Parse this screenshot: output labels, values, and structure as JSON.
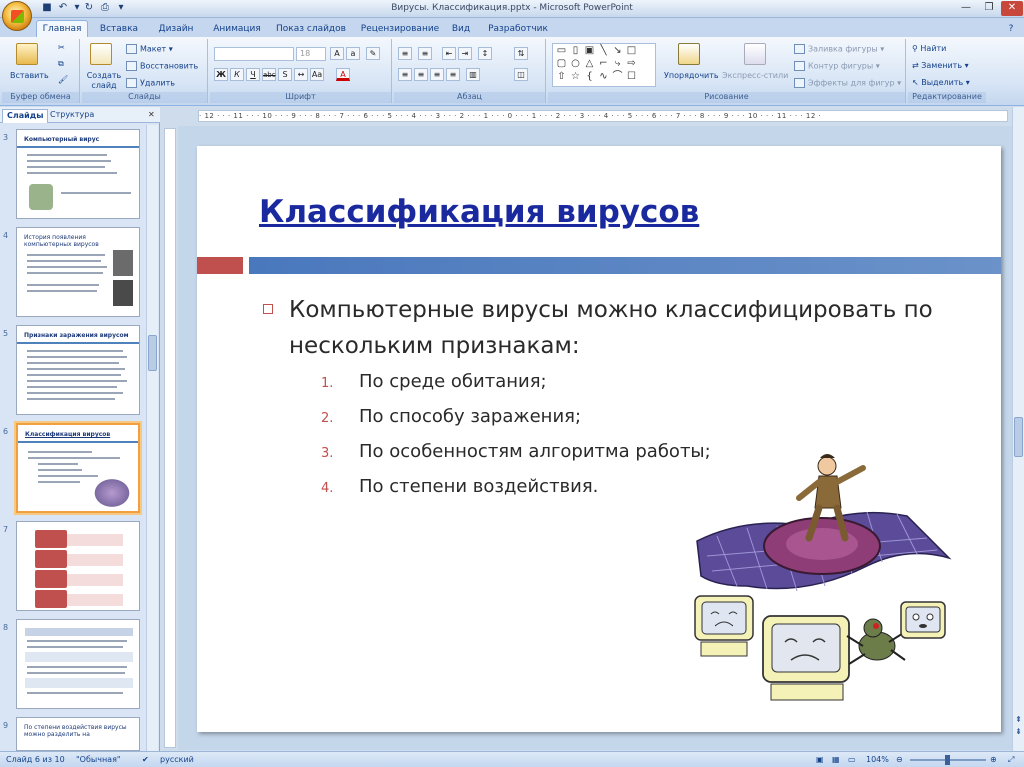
{
  "window": {
    "title": "Вирусы. Классификация.pptx - Microsoft PowerPoint"
  },
  "tabs": [
    "Главная",
    "Вставка",
    "Дизайн",
    "Анимация",
    "Показ слайдов",
    "Рецензирование",
    "Вид",
    "Разработчик"
  ],
  "ribbon": {
    "clipboard": {
      "paste": "Вставить",
      "label": "Буфер обмена"
    },
    "slides": {
      "new_slide": "Создать слайд",
      "layout": "Макет",
      "reset": "Восстановить",
      "delete": "Удалить",
      "label": "Слайды"
    },
    "font": {
      "size": "18",
      "bold": "Ж",
      "italic": "К",
      "underline": "Ч",
      "strike": "abc",
      "label": "Шрифт"
    },
    "paragraph": {
      "label": "Абзац"
    },
    "drawing": {
      "arrange": "Упорядочить",
      "quick_styles": "Экспресс-стили",
      "fill": "Заливка фигуры",
      "outline": "Контур фигуры",
      "effects": "Эффекты для фигур",
      "label": "Рисование"
    },
    "editing": {
      "find": "Найти",
      "replace": "Заменить",
      "select": "Выделить",
      "label": "Редактирование"
    }
  },
  "panel": {
    "tab_slides": "Слайды",
    "tab_outline": "Структура",
    "thumbnails": [
      {
        "num": "3",
        "title": "Компьютерный вирус"
      },
      {
        "num": "4",
        "title": "История появления компьютерных вирусов"
      },
      {
        "num": "5",
        "title": "Признаки заражения вирусом"
      },
      {
        "num": "6",
        "title": "Классификация вирусов"
      },
      {
        "num": "7",
        "title": ""
      },
      {
        "num": "8",
        "title": ""
      },
      {
        "num": "9",
        "title": "По степени воздействия вирусы можно разделить на"
      }
    ]
  },
  "ruler": {
    "h_ticks": "· 12 · · · 11 · · · 10 · · · 9 · · · 8 · · · 7 · · · 6 · · · 5 · · · 4 · · · 3 · · · 2 · · · 1 · · · 0 · · · 1 · · · 2 · · · 3 · · · 4 · · · 5 · · · 6 · · · 7 · · · 8 · · · 9 · · · 10 · · · 11 · · · 12 ·"
  },
  "slide": {
    "title": "Классификация вирусов",
    "bullet": "Компьютерные вирусы можно классифицировать по нескольким признакам:",
    "items": [
      {
        "n": "1.",
        "text": "По среде обитания;"
      },
      {
        "n": "2.",
        "text": "По способу заражения;"
      },
      {
        "n": "3.",
        "text": "По особенностям алгоритма работы;"
      },
      {
        "n": "4.",
        "text": "По степени воздействия."
      }
    ]
  },
  "status": {
    "slide": "Слайд 6 из 10",
    "theme": "\"Обычная\"",
    "lang": "русский",
    "zoom": "104%"
  },
  "colors": {
    "accent_red": "#c0504d",
    "accent_blue": "#4f81bd",
    "title_blue": "#1a2a9e"
  }
}
